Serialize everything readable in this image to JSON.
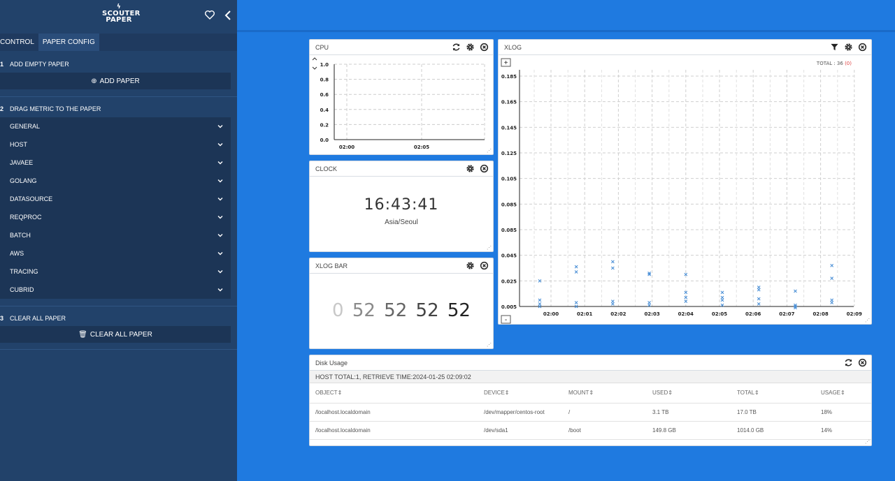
{
  "sidebar": {
    "logo": {
      "line1": "SCOUTER",
      "line2": "PAPER"
    },
    "tabs": [
      "CONTROL",
      "PAPER CONFIG"
    ],
    "steps": [
      {
        "num": "1",
        "label": "ADD EMPTY PAPER"
      },
      {
        "num": "2",
        "label": "DRAG METRIC TO THE PAPER"
      },
      {
        "num": "3",
        "label": "CLEAR ALL PAPER"
      }
    ],
    "add_paper_label": "ADD PAPER",
    "clear_all_label": "CLEAR ALL PAPER",
    "metrics": [
      "GENERAL",
      "HOST",
      "JAVAEE",
      "GOLANG",
      "DATASOURCE",
      "REQPROC",
      "BATCH",
      "AWS",
      "TRACING",
      "CUBRID"
    ]
  },
  "cpu": {
    "title": "CPU",
    "chart_data": {
      "type": "line",
      "title": "",
      "ylim": [
        0,
        1.0
      ],
      "y_ticks": [
        "1.0",
        "0.8",
        "0.6",
        "0.4",
        "0.2",
        "0.0"
      ],
      "x_ticks": [
        "02:00",
        "02:05"
      ],
      "series": []
    }
  },
  "clock": {
    "title": "CLOCK",
    "time": "16:43:41",
    "zone": "Asia/Seoul"
  },
  "xlogbar": {
    "title": "XLOG BAR",
    "values": [
      "0",
      "52",
      "52",
      "52",
      "52"
    ]
  },
  "xlog": {
    "title": "XLOG",
    "total_prefix": "TOTAL : 36",
    "total_error": "(0)",
    "zoom_in": "+",
    "zoom_out": "-",
    "chart_data": {
      "type": "scatter",
      "title": "",
      "y_ticks": [
        "0.185",
        "0.165",
        "0.145",
        "0.125",
        "0.105",
        "0.085",
        "0.085",
        "0.045",
        "0.025",
        "0.005"
      ],
      "x_ticks": [
        "02:00",
        "02:01",
        "02:02",
        "02:03",
        "02:04",
        "02:05",
        "02:06",
        "02:07",
        "02:08",
        "02:09"
      ],
      "ylim": [
        0.005,
        0.195
      ],
      "points": [
        {
          "x": "01:59:40",
          "y": 0.025
        },
        {
          "x": "01:59:40",
          "y": 0.01
        },
        {
          "x": "01:59:40",
          "y": 0.007
        },
        {
          "x": "01:59:40",
          "y": 0.005
        },
        {
          "x": "02:00:45",
          "y": 0.036
        },
        {
          "x": "02:00:45",
          "y": 0.032
        },
        {
          "x": "02:00:45",
          "y": 0.008
        },
        {
          "x": "02:00:45",
          "y": 0.005
        },
        {
          "x": "02:01:50",
          "y": 0.04
        },
        {
          "x": "02:01:50",
          "y": 0.035
        },
        {
          "x": "02:01:50",
          "y": 0.009
        },
        {
          "x": "02:01:50",
          "y": 0.007
        },
        {
          "x": "02:02:55",
          "y": 0.031
        },
        {
          "x": "02:02:55",
          "y": 0.03
        },
        {
          "x": "02:02:55",
          "y": 0.008
        },
        {
          "x": "02:02:55",
          "y": 0.006
        },
        {
          "x": "02:04:00",
          "y": 0.03
        },
        {
          "x": "02:04:00",
          "y": 0.016
        },
        {
          "x": "02:04:00",
          "y": 0.012
        },
        {
          "x": "02:04:00",
          "y": 0.009
        },
        {
          "x": "02:05:05",
          "y": 0.016
        },
        {
          "x": "02:05:05",
          "y": 0.012
        },
        {
          "x": "02:05:05",
          "y": 0.01
        },
        {
          "x": "02:05:05",
          "y": 0.006
        },
        {
          "x": "02:06:10",
          "y": 0.02
        },
        {
          "x": "02:06:10",
          "y": 0.018
        },
        {
          "x": "02:06:10",
          "y": 0.011
        },
        {
          "x": "02:06:10",
          "y": 0.007
        },
        {
          "x": "02:07:15",
          "y": 0.017
        },
        {
          "x": "02:07:15",
          "y": 0.006
        },
        {
          "x": "02:07:15",
          "y": 0.005
        },
        {
          "x": "02:07:15",
          "y": 0.004
        },
        {
          "x": "02:08:20",
          "y": 0.037
        },
        {
          "x": "02:08:20",
          "y": 0.027
        },
        {
          "x": "02:08:20",
          "y": 0.01
        },
        {
          "x": "02:08:20",
          "y": 0.008
        }
      ]
    }
  },
  "disk": {
    "title": "Disk Usage",
    "host_line": "HOST TOTAL:1, RETRIEVE TIME:2024-01-25 02:09:02",
    "columns": [
      "OBJECT",
      "DEVICE",
      "MOUNT",
      "USED",
      "TOTAL",
      "USAGE"
    ],
    "rows": [
      [
        "/localhost.localdomain",
        "/dev/mapper/centos-root",
        "/",
        "3.1 TB",
        "17.0 TB",
        "18%"
      ],
      [
        "/localhost.localdomain",
        "/dev/sda1",
        "/boot",
        "149.8 GB",
        "1014.0 GB",
        "14%"
      ]
    ]
  },
  "colors": {
    "background": "#1f7ae0",
    "sidebar": "#22426a",
    "sidebar_panel": "#1c3556",
    "xlog_point": "#4a8fd6",
    "error": "#e04040"
  }
}
